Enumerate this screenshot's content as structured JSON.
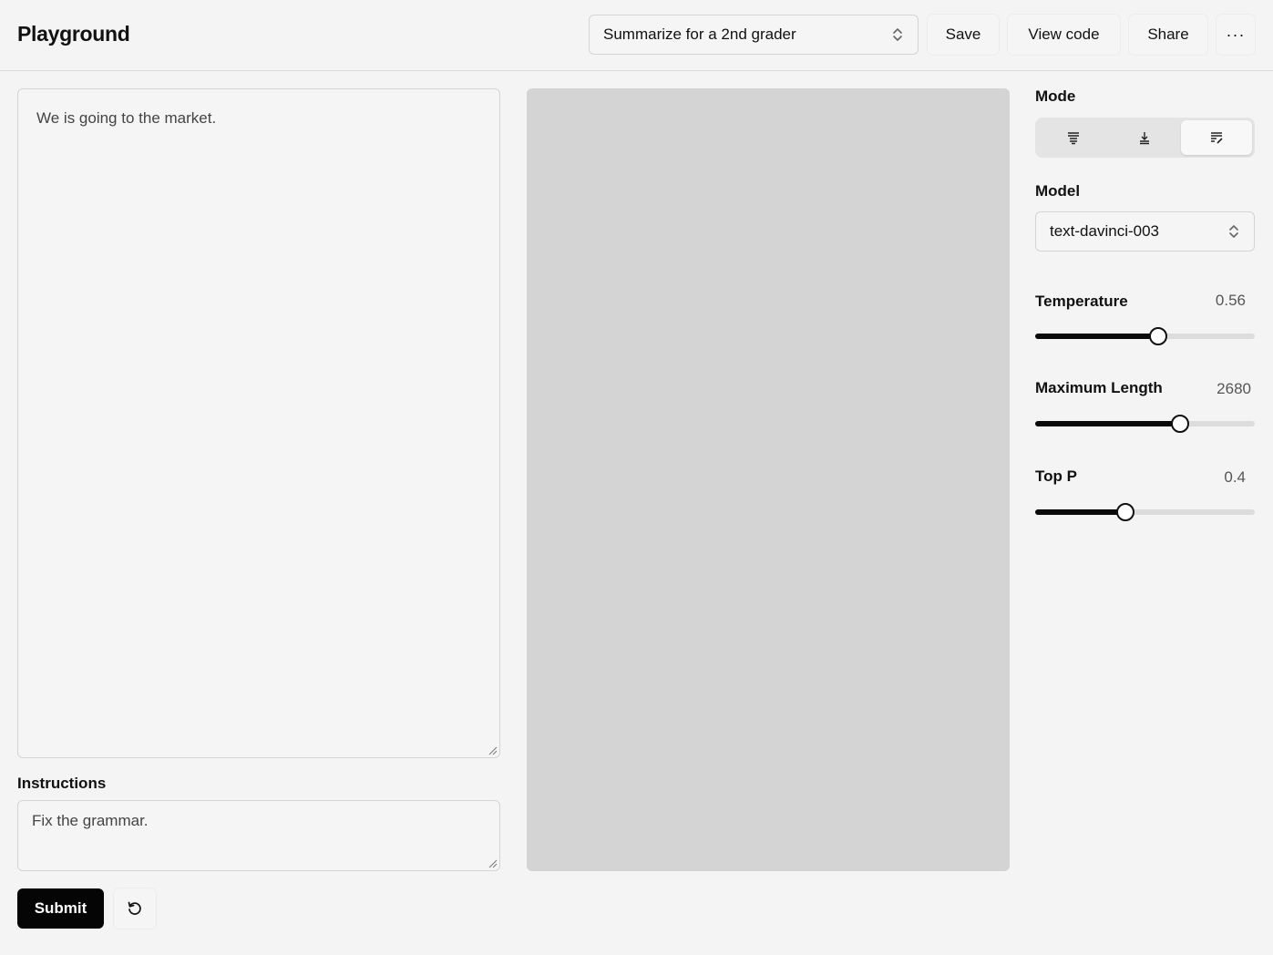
{
  "header": {
    "title": "Playground",
    "preset": "Summarize for a 2nd grader",
    "save_label": "Save",
    "view_code_label": "View code",
    "share_label": "Share",
    "more_label": "···"
  },
  "editor": {
    "input_text": "We is going to the market.",
    "instructions_label": "Instructions",
    "instructions_text": "Fix the grammar.",
    "submit_label": "Submit"
  },
  "sidebar": {
    "mode_label": "Mode",
    "mode_options": [
      "complete-icon",
      "insert-icon",
      "edit-icon"
    ],
    "mode_selected": "edit-icon",
    "model_label": "Model",
    "model_value": "text-davinci-003",
    "params": [
      {
        "label": "Temperature",
        "value": "0.56",
        "fraction": 0.56
      },
      {
        "label": "Maximum Length",
        "value": "2680",
        "fraction": 0.66
      },
      {
        "label": "Top P",
        "value": "0.4",
        "fraction": 0.41
      }
    ]
  },
  "colors": {
    "background": "#f4f4f4",
    "output_panel": "#d4d4d4",
    "accent": "#050505"
  }
}
